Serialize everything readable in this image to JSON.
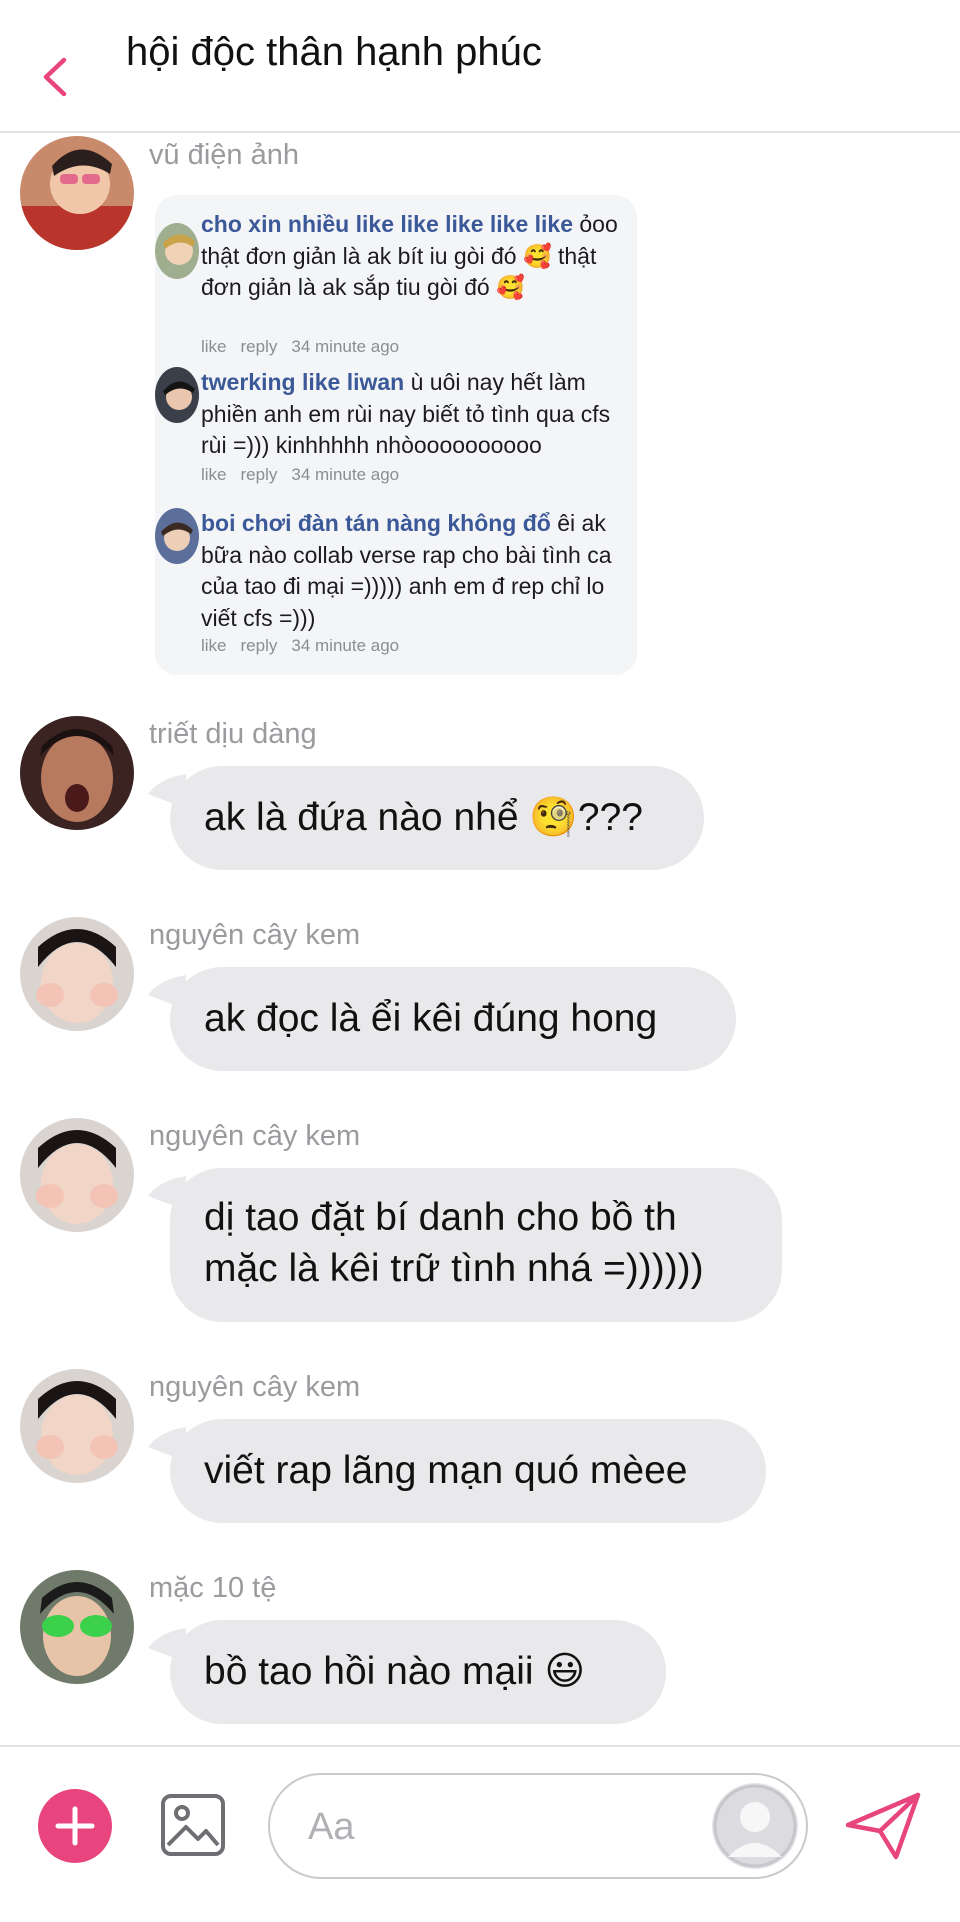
{
  "header": {
    "title": "hội độc thân hạnh phúc"
  },
  "messages": [
    {
      "sender": "vũ điện ảnh",
      "type": "comment_card",
      "comments": [
        {
          "name": "cho xin nhiều like like like like like",
          "text": " ỏoo thật đơn giản là ak bít iu gòi đó 🥰 thật đơn giản là ak sắp tiu gòi đó 🥰",
          "like": "like",
          "reply": "reply",
          "time": "34 minute ago"
        },
        {
          "name": "twerking like liwan",
          "text": " ù uôi nay hết làm phiền anh em rùi nay biết tỏ tình qua cfs rùi =))) kinhhhhh nhòoooooooooo",
          "like": "like",
          "reply": "reply",
          "time": "34 minute ago"
        },
        {
          "name": "boi chơi đàn tán nàng không đổ",
          "text": " êi ak bữa nào collab verse rap cho bài tình ca của tao đi mại =))))) anh em đ rep chỉ lo viết cfs =)))",
          "like": "like",
          "reply": "reply",
          "time": "34 minute ago"
        }
      ]
    },
    {
      "sender": "triết dịu dàng",
      "text": "ak là đứa nào nhể 🧐???"
    },
    {
      "sender": "nguyên cây kem",
      "text": "ak đọc là ểi kêi đúng hong"
    },
    {
      "sender": "nguyên cây kem",
      "lines": [
        "dị tao đặt bí danh cho bồ th",
        "mặc là kêi trữ tình nhá =))))))"
      ]
    },
    {
      "sender": "nguyên cây kem",
      "text": "viết rap lãng mạn quó mèee"
    },
    {
      "sender": "mặc 10 tệ",
      "text": "bồ tao hồi nào mạii 😃"
    }
  ],
  "composer": {
    "placeholder": "Aa"
  },
  "colors": {
    "accent": "#e8457f",
    "bubble": "#e9e9ec",
    "link": "#3b5998"
  },
  "icons": [
    "chevron-left-icon",
    "plus-icon",
    "image-icon",
    "profile-icon",
    "send-icon"
  ]
}
